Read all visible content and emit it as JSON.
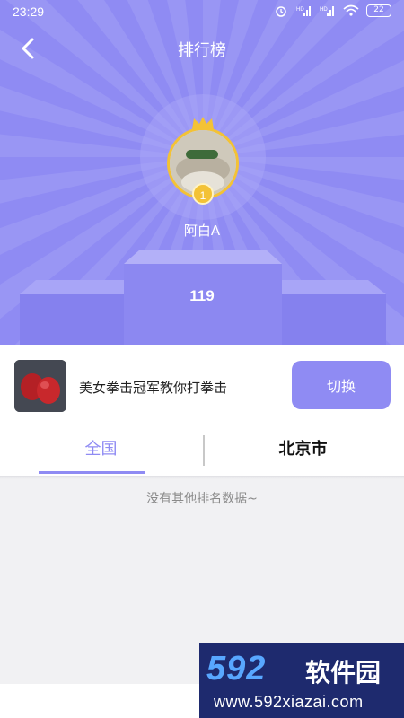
{
  "status_bar": {
    "time": "23:29",
    "battery": "22"
  },
  "header": {
    "title": "排行榜"
  },
  "top_user": {
    "rank": "1",
    "name": "阿白A",
    "score": "119"
  },
  "video": {
    "title": "美女拳击冠军教你打拳击",
    "switch_label": "切换"
  },
  "tabs": [
    {
      "label": "全国"
    },
    {
      "label": "北京市"
    }
  ],
  "empty_message": "没有其他排名数据~",
  "watermark": {
    "logo": "592",
    "name": "软件园",
    "url": "www.592xiazai.com"
  },
  "colors": {
    "accent": "#8f8bf3",
    "gold": "#f3c236",
    "watermark_bg": "#1e2a6e"
  }
}
